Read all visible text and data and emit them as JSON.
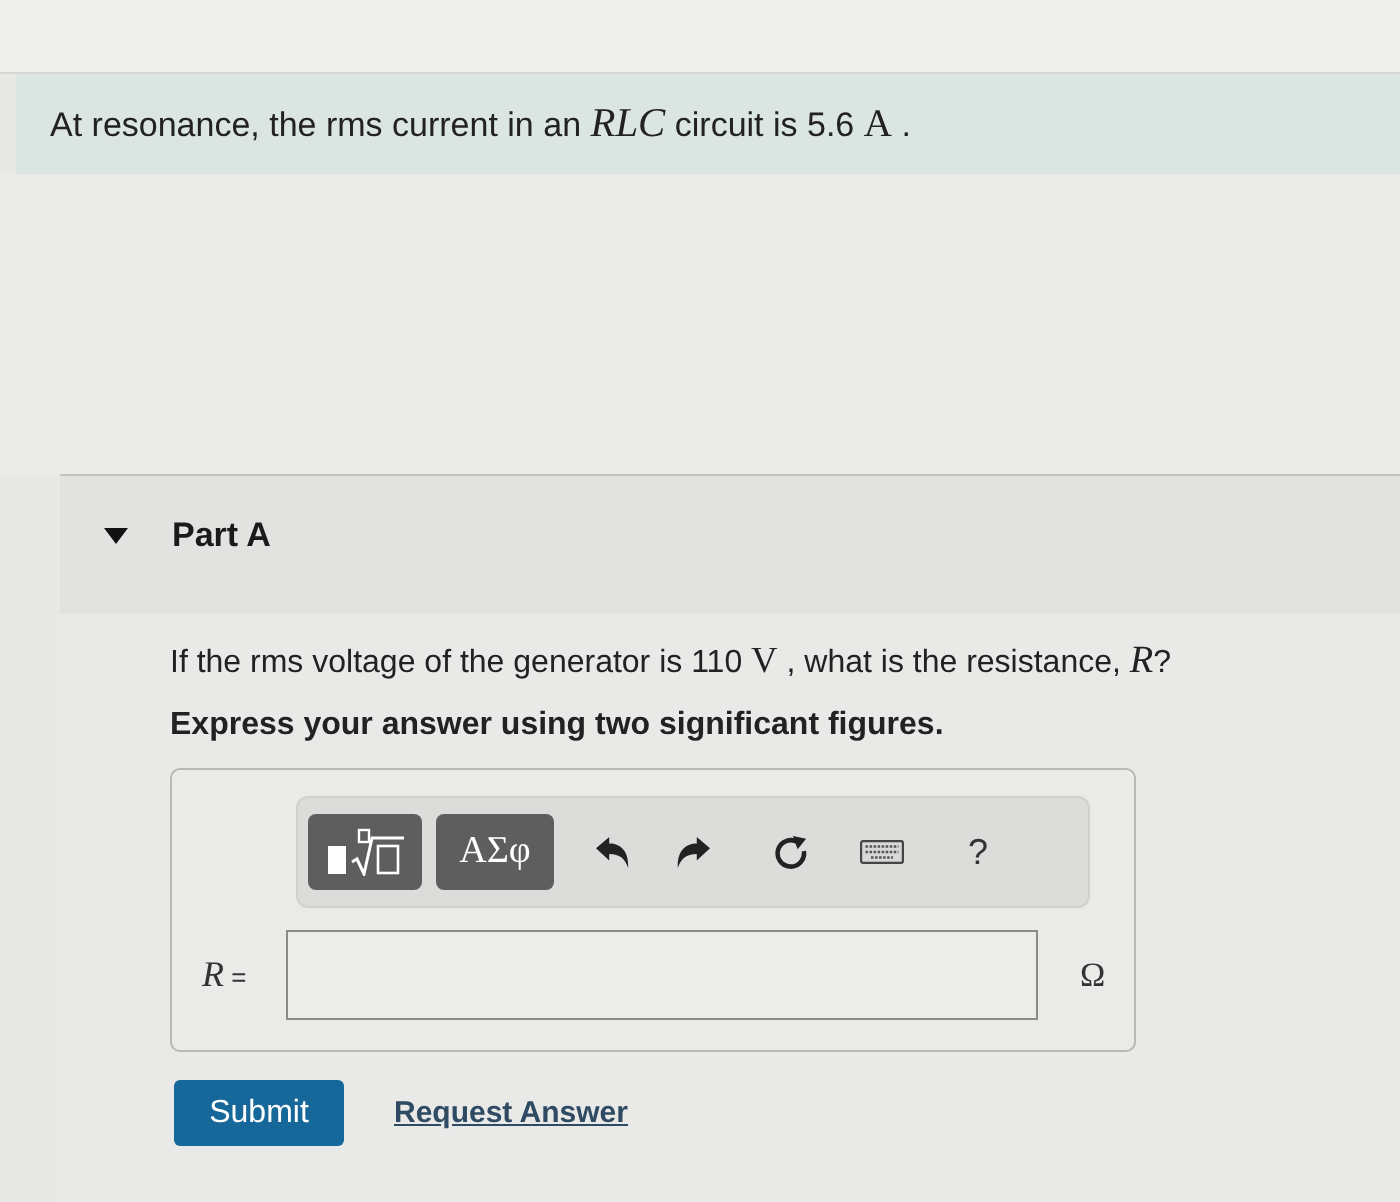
{
  "problem": {
    "statement": [
      {
        "kind": "text",
        "text": "At resonance, the rms current in an "
      },
      {
        "kind": "var",
        "text": "RLC"
      },
      {
        "kind": "text",
        "text": " circuit is 5.6 "
      },
      {
        "kind": "unit",
        "text": "A"
      },
      {
        "kind": "text",
        "text": " ."
      }
    ]
  },
  "part": {
    "title": "Part A",
    "expanded": true,
    "question": [
      {
        "kind": "text",
        "text": "If the rms voltage of the generator is 110 "
      },
      {
        "kind": "unit",
        "text": "V"
      },
      {
        "kind": "text",
        "text": " , what is the resistance, "
      },
      {
        "kind": "var",
        "text": "R"
      },
      {
        "kind": "text",
        "text": "?"
      }
    ],
    "instruction": "Express your answer using two significant figures.",
    "toolbar": {
      "symbols_label": "ΑΣφ",
      "help_label": "?"
    },
    "answer": {
      "label": [
        {
          "kind": "var",
          "text": "R"
        },
        {
          "kind": "text",
          "text": " ="
        }
      ],
      "unit": "Ω"
    },
    "submit": "Submit",
    "request_answer": "Request Answer"
  }
}
